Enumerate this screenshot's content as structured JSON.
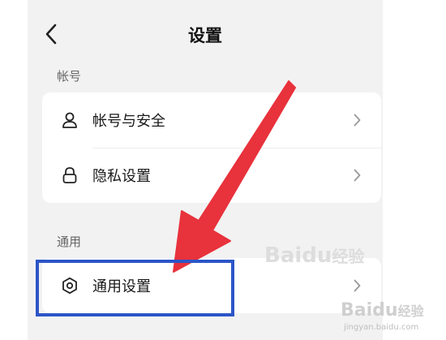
{
  "nav": {
    "title": "设置"
  },
  "sections": {
    "account": {
      "label": "帐号",
      "items": [
        {
          "label": "帐号与安全",
          "icon": "user-icon"
        },
        {
          "label": "隐私设置",
          "icon": "lock-icon"
        }
      ]
    },
    "general": {
      "label": "通用",
      "items": [
        {
          "label": "通用设置",
          "icon": "gear-icon"
        }
      ]
    }
  },
  "watermark": {
    "brand_main": "Bai",
    "brand_paw": "du",
    "brand_cn": "经验",
    "url": "jingyan.baidu.com"
  },
  "colors": {
    "arrow": "#e8323c",
    "highlight_box": "#2c55c8",
    "background": "#f2f2f2"
  }
}
